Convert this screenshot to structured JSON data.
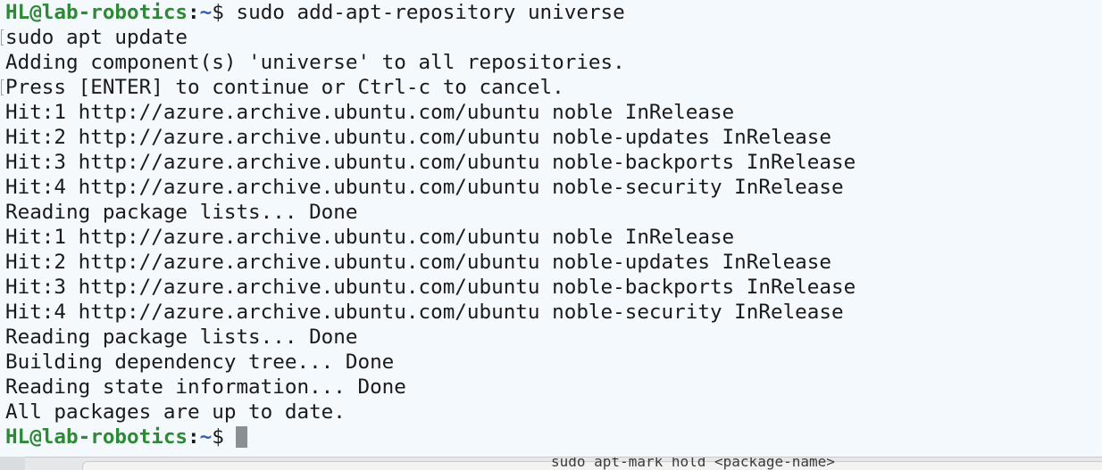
{
  "terminal": {
    "prompt": {
      "user_host": "HL@lab-robotics",
      "separator": ":",
      "path": "~",
      "symbol": "$ "
    },
    "command": "sudo add-apt-repository universe",
    "lines": [
      "sudo apt update",
      "Adding component(s) 'universe' to all repositories.",
      "Press [ENTER] to continue or Ctrl-c to cancel.",
      "Hit:1 http://azure.archive.ubuntu.com/ubuntu noble InRelease",
      "Hit:2 http://azure.archive.ubuntu.com/ubuntu noble-updates InRelease",
      "Hit:3 http://azure.archive.ubuntu.com/ubuntu noble-backports InRelease",
      "Hit:4 http://azure.archive.ubuntu.com/ubuntu noble-security InRelease",
      "Reading package lists... Done",
      "Hit:1 http://azure.archive.ubuntu.com/ubuntu noble InRelease",
      "Hit:2 http://azure.archive.ubuntu.com/ubuntu noble-updates InRelease",
      "Hit:3 http://azure.archive.ubuntu.com/ubuntu noble-backports InRelease",
      "Hit:4 http://azure.archive.ubuntu.com/ubuntu noble-security InRelease",
      "Reading package lists... Done",
      "Building dependency tree... Done",
      "Reading state information... Done",
      "All packages are up to date."
    ]
  },
  "background_window": {
    "partial_text": "sudo apt-mark hold <package-name>"
  },
  "colors": {
    "terminal_bg": "#f4f9fd",
    "text": "#1a1a1a",
    "prompt_user": "#2d8a34",
    "prompt_path": "#2f5db8",
    "cursor": "#8a8f94"
  }
}
